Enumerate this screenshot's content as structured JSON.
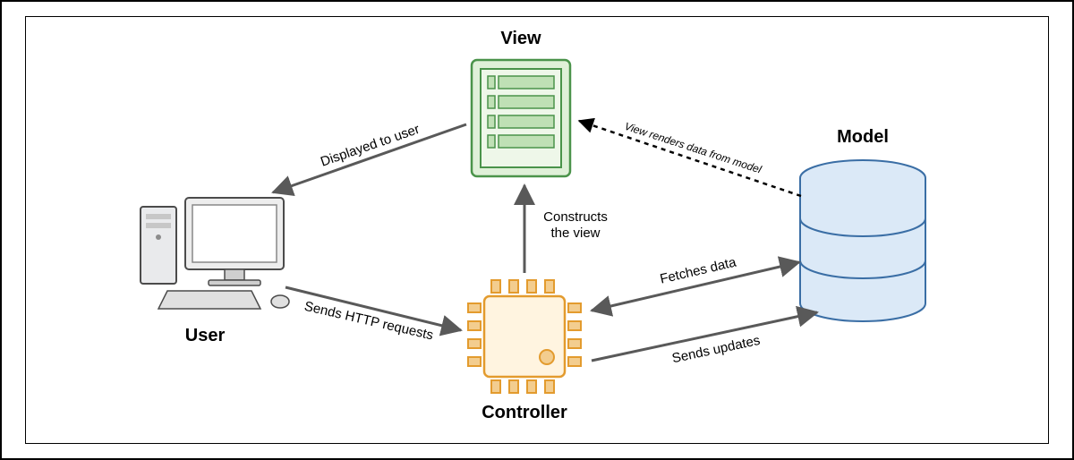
{
  "diagram": {
    "nodes": {
      "view": "View",
      "user": "User",
      "controller": "Controller",
      "model": "Model"
    },
    "edges": {
      "view_to_user": "Displayed to user",
      "user_to_controller": "Sends HTTP requests",
      "controller_to_view_l1": "Constructs",
      "controller_to_view_l2": "the view",
      "controller_model_fetch": "Fetches data",
      "controller_to_model_update": "Sends updates",
      "model_to_view": "View renders data from model"
    }
  }
}
